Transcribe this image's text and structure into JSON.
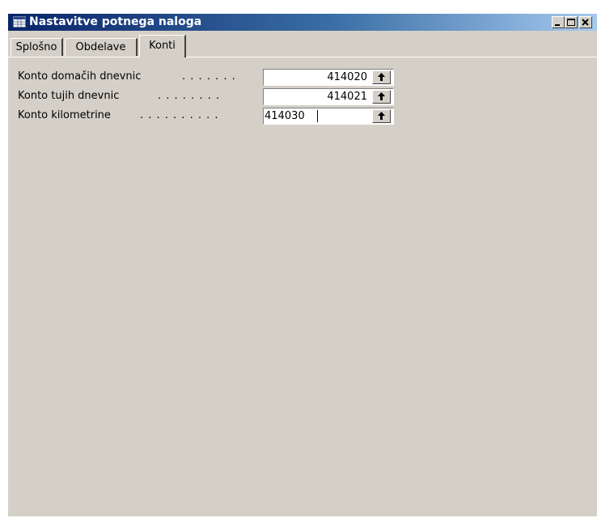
{
  "window": {
    "title": "Nastavitve potnega naloga",
    "controls": [
      "minimize",
      "maximize",
      "close"
    ]
  },
  "tabs": [
    {
      "label": "Splošno",
      "active": false
    },
    {
      "label": "Obdelave",
      "active": false
    },
    {
      "label": "Konti",
      "active": true
    }
  ],
  "fields": [
    {
      "label": "Konto domačih dnevnic",
      "dots": ". . . . . . .",
      "value": "414020",
      "align": "right",
      "focused": false
    },
    {
      "label": "Konto tujih dnevnic",
      "dots": ". . . . . . . .",
      "value": "414021",
      "align": "right",
      "focused": false
    },
    {
      "label": "Konto kilometrine",
      "dots": ". . . . . . . . . .",
      "value": "414030",
      "align": "left",
      "focused": true
    }
  ],
  "icons": {
    "window": "form-icon",
    "lookup": "arrow-up-icon"
  }
}
